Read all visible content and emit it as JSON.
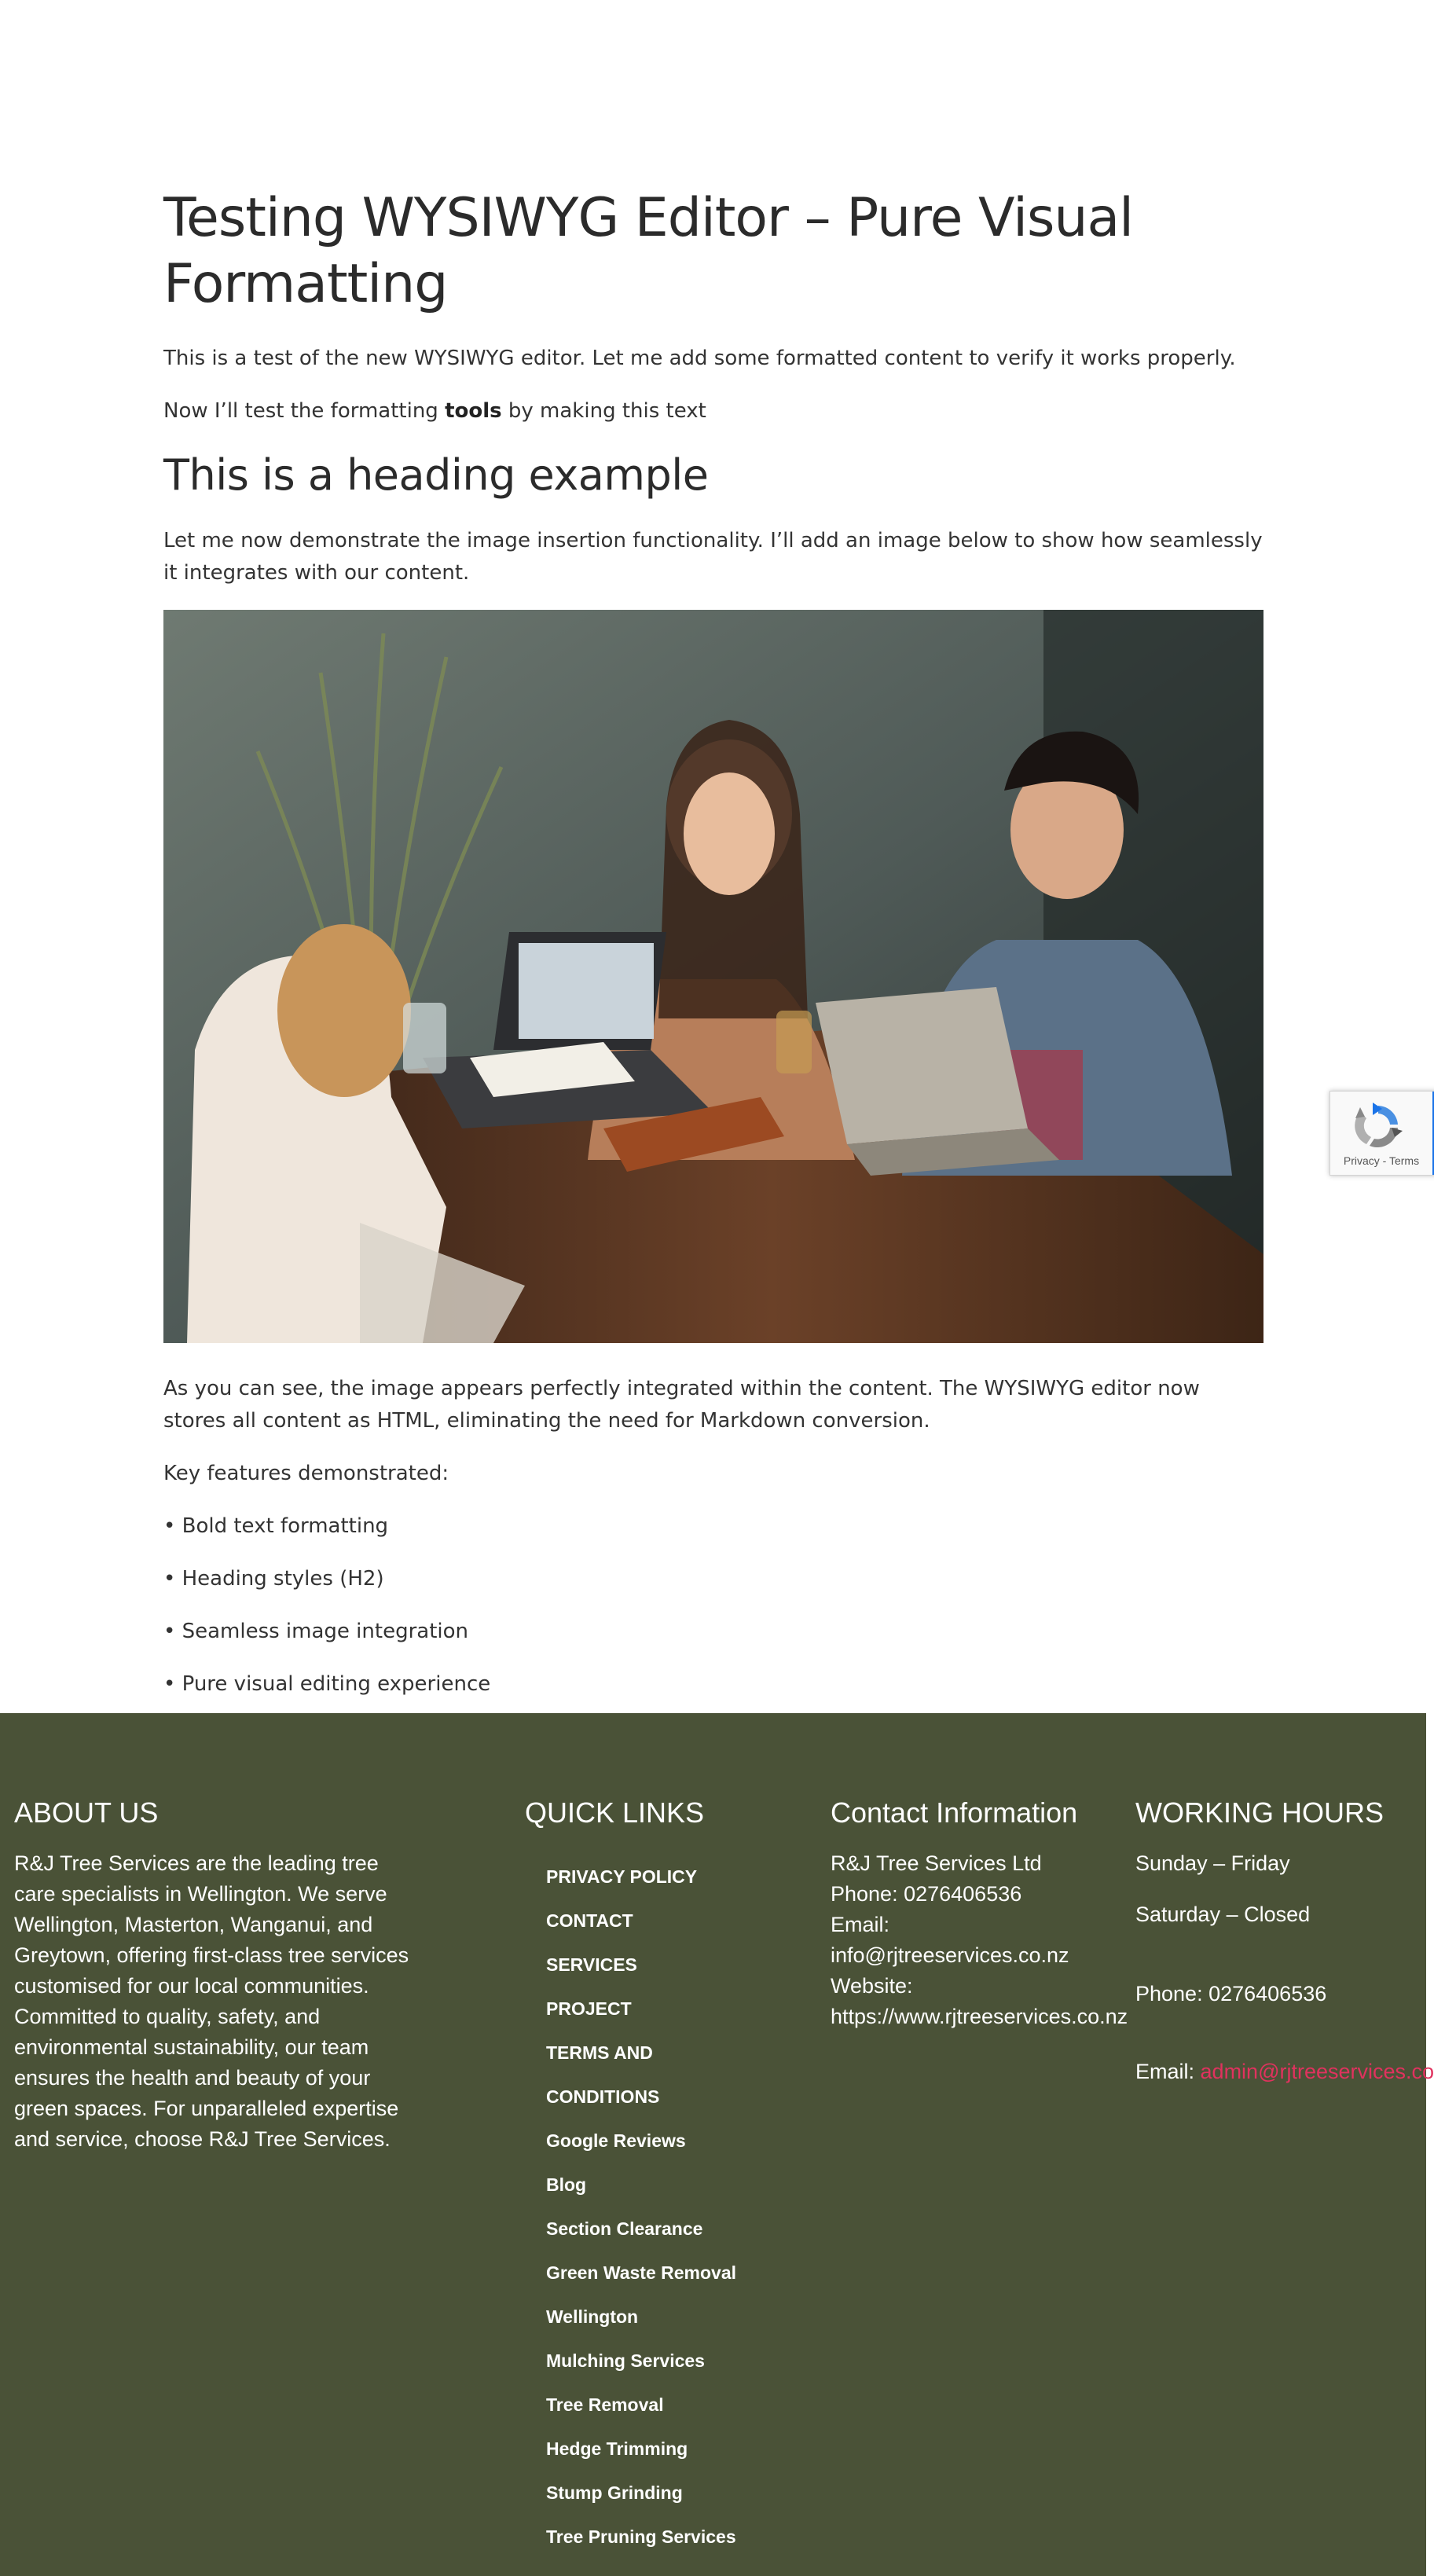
{
  "article": {
    "title": "Testing WYSIWYG Editor – Pure Visual Formatting",
    "intro": "This is a test of the new WYSIWYG editor. Let me add some formatted content to verify it works properly.",
    "formatting_prefix": "Now I’ll test the formatting ",
    "formatting_bold": "tools",
    "formatting_suffix": " by making this text",
    "heading": "This is a heading example",
    "image_intro": "Let me now demonstrate the image insertion functionality. I’ll add an image below to show how seamlessly it integrates with our content.",
    "after_image": "As you can see, the image appears perfectly integrated within the content. The WYSIWYG editor now stores all content as HTML, eliminating the need for Markdown conversion.",
    "features_label": "Key features demonstrated:",
    "features": [
      "• Bold text formatting",
      "• Heading styles (H2)",
      "• Seamless image integration",
      "• Pure visual editing experience"
    ]
  },
  "recaptcha": {
    "links": "Privacy - Terms"
  },
  "footer": {
    "about": {
      "heading": "ABOUT US",
      "text": "R&J Tree Services are the leading tree care specialists in Wellington. We serve Wellington, Masterton, Wanganui, and Greytown, offering first-class tree services customised for our local communities. Committed to quality, safety, and environmental sustainability, our team ensures the health and beauty of your green spaces. For unparalleled expertise and service, choose R&J Tree Services."
    },
    "quick_links": {
      "heading": "QUICK LINKS",
      "items": [
        "PRIVACY POLICY",
        "CONTACT",
        "SERVICES",
        "PROJECT",
        "TERMS AND",
        "CONDITIONS",
        "Google Reviews",
        "Blog",
        "Section Clearance",
        "Green Waste Removal",
        "Wellington",
        "Mulching Services",
        "Tree Removal",
        "Hedge Trimming",
        "Stump Grinding",
        "Tree Pruning Services"
      ]
    },
    "contact": {
      "heading": "Contact Information",
      "lines": [
        "R&J Tree Services Ltd",
        "Phone: 0276406536",
        "Email:",
        "info@rjtreeservices.co.nz",
        "Website:",
        "https://www.rjtreeservices.co.nz"
      ]
    },
    "hours": {
      "heading": "WORKING HOURS",
      "weekdays": "Sunday – Friday",
      "saturday": "Saturday – Closed",
      "phone": "Phone: 0276406536",
      "email_label": "Email: ",
      "email": "admin@rjtreeservices.co.nz",
      "email_color": "#e0325e"
    },
    "background_color": "#4a5237"
  }
}
